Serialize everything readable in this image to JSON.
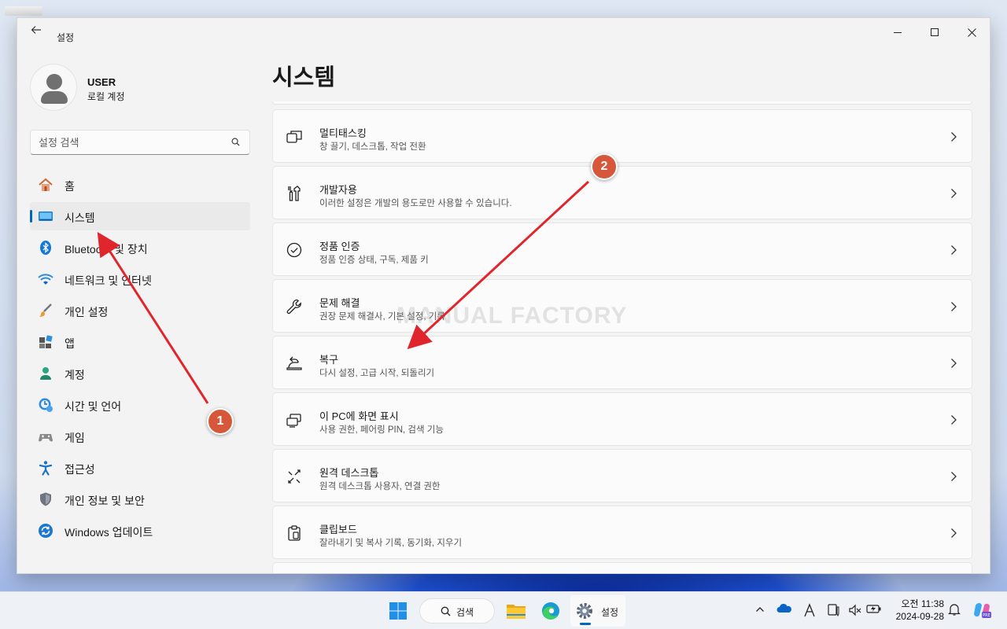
{
  "window": {
    "title": "설정"
  },
  "profile": {
    "name": "USER",
    "account_type": "로컬 계정"
  },
  "search": {
    "placeholder": "설정 검색"
  },
  "nav": {
    "items": [
      {
        "label": "홈",
        "icon": "home-icon"
      },
      {
        "label": "시스템",
        "icon": "system-icon",
        "active": true
      },
      {
        "label": "Bluetooth 및 장치",
        "icon": "bluetooth-icon"
      },
      {
        "label": "네트워크 및 인터넷",
        "icon": "network-icon"
      },
      {
        "label": "개인 설정",
        "icon": "personalization-brush-icon"
      },
      {
        "label": "앱",
        "icon": "apps-icon"
      },
      {
        "label": "계정",
        "icon": "accounts-icon"
      },
      {
        "label": "시간 및 언어",
        "icon": "time-language-icon"
      },
      {
        "label": "게임",
        "icon": "gaming-icon"
      },
      {
        "label": "접근성",
        "icon": "accessibility-icon"
      },
      {
        "label": "개인 정보 및 보안",
        "icon": "privacy-shield-icon"
      },
      {
        "label": "Windows 업데이트",
        "icon": "windows-update-icon"
      }
    ]
  },
  "main": {
    "title": "시스템",
    "cards": [
      {
        "title": "멀티태스킹",
        "desc": "창 끌기, 데스크톱, 작업 전환",
        "icon": "multitasking-icon"
      },
      {
        "title": "개발자용",
        "desc": "이러한 설정은 개발의 용도로만 사용할 수 있습니다.",
        "icon": "developer-tools-icon"
      },
      {
        "title": "정품 인증",
        "desc": "정품 인증 상태, 구독, 제품 키",
        "icon": "activation-check-icon"
      },
      {
        "title": "문제 해결",
        "desc": "권장 문제 해결사, 기본 설정, 기록",
        "icon": "troubleshoot-wrench-icon"
      },
      {
        "title": "복구",
        "desc": "다시 설정, 고급 시작, 되돌리기",
        "icon": "recovery-icon"
      },
      {
        "title": "이 PC에 화면 표시",
        "desc": "사용 권한, 페어링 PIN, 검색 기능",
        "icon": "project-to-pc-icon"
      },
      {
        "title": "원격 데스크톱",
        "desc": "원격 데스크톱 사용자, 연결 권한",
        "icon": "remote-desktop-icon"
      },
      {
        "title": "클립보드",
        "desc": "잘라내기 및 복사 기록, 동기화, 지우기",
        "icon": "clipboard-icon"
      }
    ]
  },
  "watermark": "MANUAL FACTORY",
  "annotations": {
    "badge1": "1",
    "badge2": "2"
  },
  "taskbar": {
    "search_label": "검색",
    "settings_label": "설정",
    "time": "오전 11:38",
    "date": "2024-09-28"
  },
  "colors": {
    "accent": "#0067c0",
    "badge": "#d7573a",
    "arrow": "#e0262c"
  }
}
